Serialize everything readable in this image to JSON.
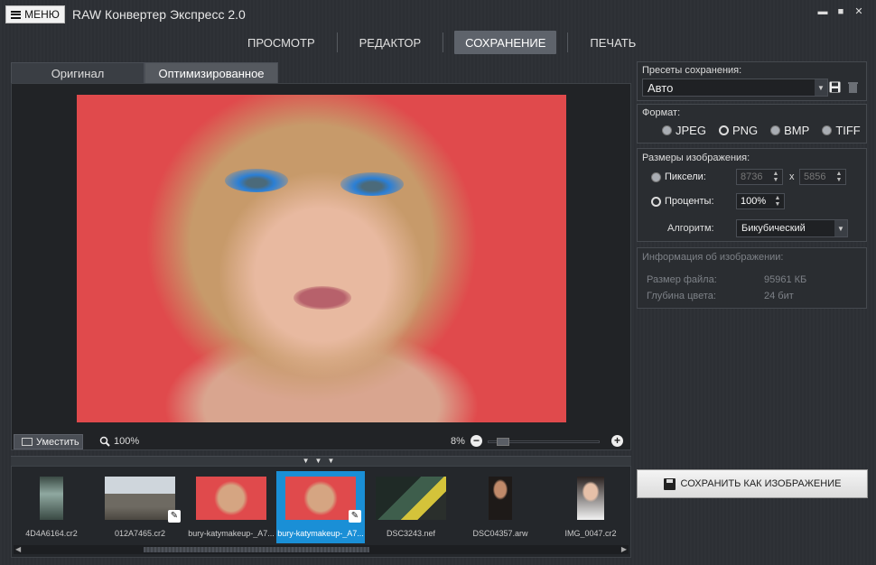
{
  "app": {
    "menu_label": "МЕНЮ",
    "title": "RAW Конвертер Экспресс 2.0"
  },
  "window_controls": {
    "minimize": "▬",
    "maximize": "■",
    "close": "✕"
  },
  "nav": {
    "tabs": [
      "ПРОСМОТР",
      "РЕДАКТОР",
      "СОХРАНЕНИЕ",
      "ПЕЧАТЬ"
    ],
    "active": "СОХРАНЕНИЕ"
  },
  "view_tabs": {
    "original": "Оригинал",
    "optimized": "Оптимизированное",
    "active": "Оптимизированное"
  },
  "viewer": {
    "fit_label": "Уместить",
    "zoom_label": "100%",
    "scale_pct": "8%",
    "zoom_minus": "−",
    "zoom_plus": "+",
    "slider_level": 0.08
  },
  "strip_handle": "▼▼▼",
  "filmstrip": {
    "items": [
      {
        "name": "4D4A6164.cr2",
        "edited": false,
        "selected": false
      },
      {
        "name": "012A7465.cr2",
        "edited": true,
        "selected": false
      },
      {
        "name": "bury-katymakeup-_A7...",
        "edited": false,
        "selected": false
      },
      {
        "name": "bury-katymakeup-_A7...",
        "edited": true,
        "selected": true
      },
      {
        "name": "DSC3243.nef",
        "edited": false,
        "selected": false
      },
      {
        "name": "DSC04357.arw",
        "edited": false,
        "selected": false
      },
      {
        "name": "IMG_0047.cr2",
        "edited": false,
        "selected": false
      }
    ],
    "edit_icon": "✎"
  },
  "presets": {
    "label": "Пресеты сохранения:",
    "value": "Авто"
  },
  "format": {
    "label": "Формат:",
    "options": [
      "JPEG",
      "PNG",
      "BMP",
      "TIFF"
    ],
    "selected": "PNG"
  },
  "size": {
    "label": "Размеры изображения:",
    "pixels_label": "Пиксели:",
    "width": "8736",
    "x_sep": "x",
    "height": "5856",
    "percent_label": "Проценты:",
    "percent": "100%",
    "algorithm_label": "Алгоритм:",
    "algorithm": "Бикубический",
    "selected": "percent"
  },
  "info": {
    "label": "Информация об изображении:",
    "file_size_label": "Размер файла:",
    "file_size": "95961 КБ",
    "depth_label": "Глубина цвета:",
    "depth": "24 бит"
  },
  "save_button": {
    "label": "СОХРАНИТЬ КАК ИЗОБРАЖЕНИЕ"
  },
  "colors": {
    "accent": "#1a8fd6",
    "photo_bg": "#e04a4c",
    "panel": "#2a2d31"
  }
}
